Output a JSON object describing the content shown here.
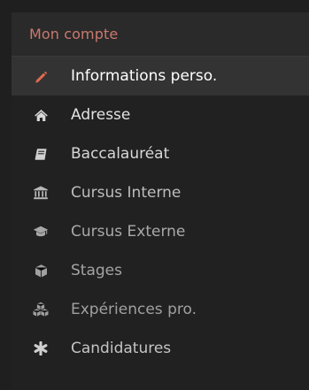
{
  "header": {
    "title": "Mon compte",
    "title_color": "#c97a6f"
  },
  "menu": {
    "items": [
      {
        "label": "Informations perso.",
        "icon": "pencil-icon",
        "active": true,
        "icon_color": "#e06b4f"
      },
      {
        "label": "Adresse",
        "icon": "home-icon",
        "active": false
      },
      {
        "label": "Baccalauréat",
        "icon": "book-icon",
        "active": false
      },
      {
        "label": "Cursus Interne",
        "icon": "institution-icon",
        "active": false
      },
      {
        "label": "Cursus Externe",
        "icon": "graduation-cap-icon",
        "active": false
      },
      {
        "label": "Stages",
        "icon": "cube-icon",
        "active": false
      },
      {
        "label": "Expériences pro.",
        "icon": "cubes-icon",
        "active": false
      },
      {
        "label": "Candidatures",
        "icon": "asterisk-icon",
        "active": false
      }
    ]
  }
}
